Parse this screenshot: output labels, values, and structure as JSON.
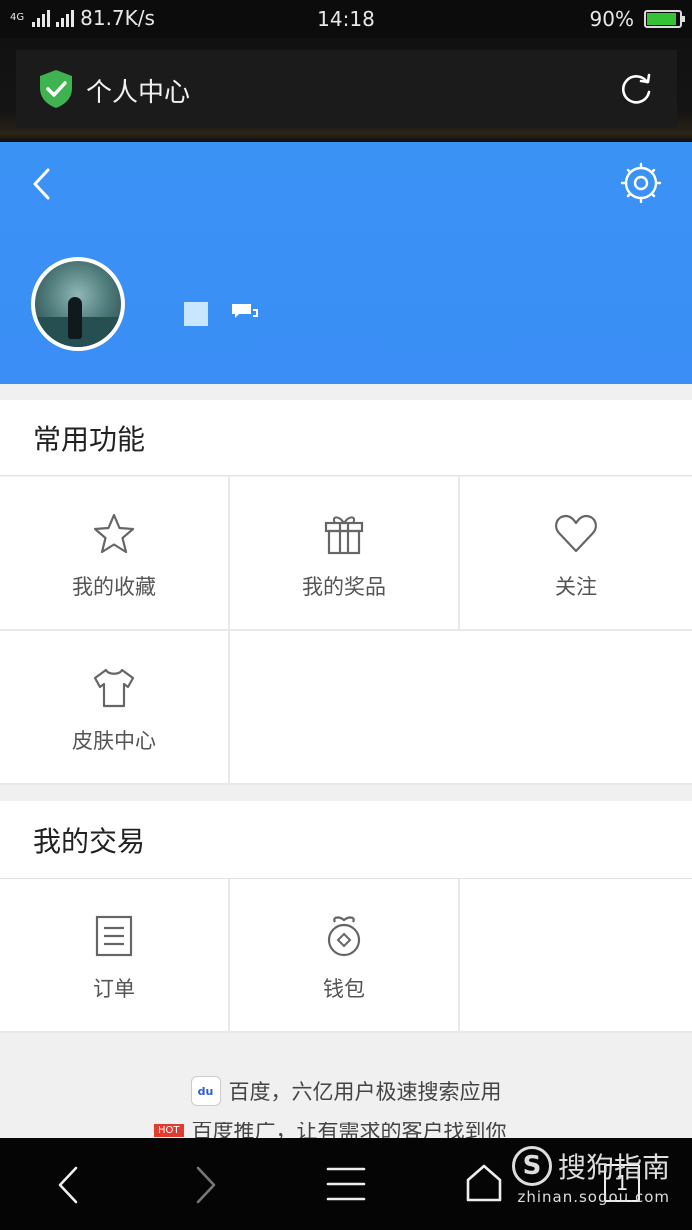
{
  "status_bar": {
    "network_type": "4G",
    "speed": "81.7K/s",
    "time": "14:18",
    "battery": "90%"
  },
  "app_bar": {
    "title": "个人中心"
  },
  "profile": {
    "accent_color": "#3b92f5"
  },
  "common_functions": {
    "title": "常用功能",
    "items": [
      {
        "label": "我的收藏",
        "icon": "star-icon"
      },
      {
        "label": "我的奖品",
        "icon": "gift-icon"
      },
      {
        "label": "关注",
        "icon": "heart-icon"
      },
      {
        "label": "皮肤中心",
        "icon": "tshirt-icon"
      }
    ]
  },
  "transactions": {
    "title": "我的交易",
    "items": [
      {
        "label": "订单",
        "icon": "order-list-icon"
      },
      {
        "label": "钱包",
        "icon": "wallet-icon"
      }
    ]
  },
  "promo": {
    "baidu_icon_text": "du",
    "line1": "百度，六亿用户极速搜索应用",
    "hot_badge": "HOT",
    "line2": "百度推广，让有需求的客户找到你"
  },
  "nav_bar": {
    "tab_count": "1"
  },
  "watermark": {
    "brand": "搜狗指南",
    "url": "zhinan.sogou.com"
  }
}
